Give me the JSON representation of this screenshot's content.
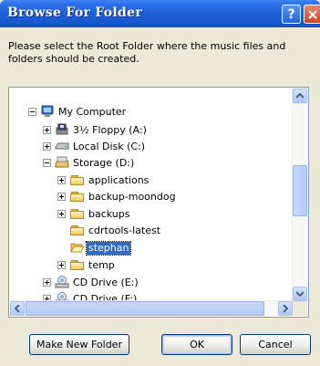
{
  "window": {
    "title": "Browse For Folder",
    "help_label": "?"
  },
  "description": "Please select the Root Folder where the music files and folders should be created.",
  "tree": {
    "items": [
      {
        "label": "My Computer",
        "icon": "computer-icon",
        "expander": "minus"
      },
      {
        "label": "3½ Floppy (A:)",
        "icon": "floppy-drive-icon",
        "expander": "plus"
      },
      {
        "label": "Local Disk (C:)",
        "icon": "hard-drive-icon",
        "expander": "plus"
      },
      {
        "label": "Storage (D:)",
        "icon": "hard-drive-icon",
        "expander": "minus"
      },
      {
        "label": "applications",
        "icon": "folder-icon",
        "expander": "plus"
      },
      {
        "label": "backup-moondog",
        "icon": "folder-icon",
        "expander": "plus"
      },
      {
        "label": "backups",
        "icon": "folder-icon",
        "expander": "plus"
      },
      {
        "label": "cdrtools-latest",
        "icon": "folder-icon",
        "expander": "none"
      },
      {
        "label": "stephan",
        "icon": "open-folder-icon",
        "expander": "none",
        "selected": true
      },
      {
        "label": "temp",
        "icon": "folder-icon",
        "expander": "plus"
      },
      {
        "label": "CD Drive (E:)",
        "icon": "cd-drive-icon",
        "expander": "plus"
      },
      {
        "label": "CD Drive (F:)",
        "icon": "cd-drive-icon",
        "expander": "plus"
      }
    ]
  },
  "buttons": {
    "make_new_folder": "Make New Folder",
    "ok": "OK",
    "cancel": "Cancel"
  },
  "colors": {
    "titlebar": "#1f5fd8",
    "selection": "#316ac5",
    "dialog_bg": "#ece9d8"
  }
}
